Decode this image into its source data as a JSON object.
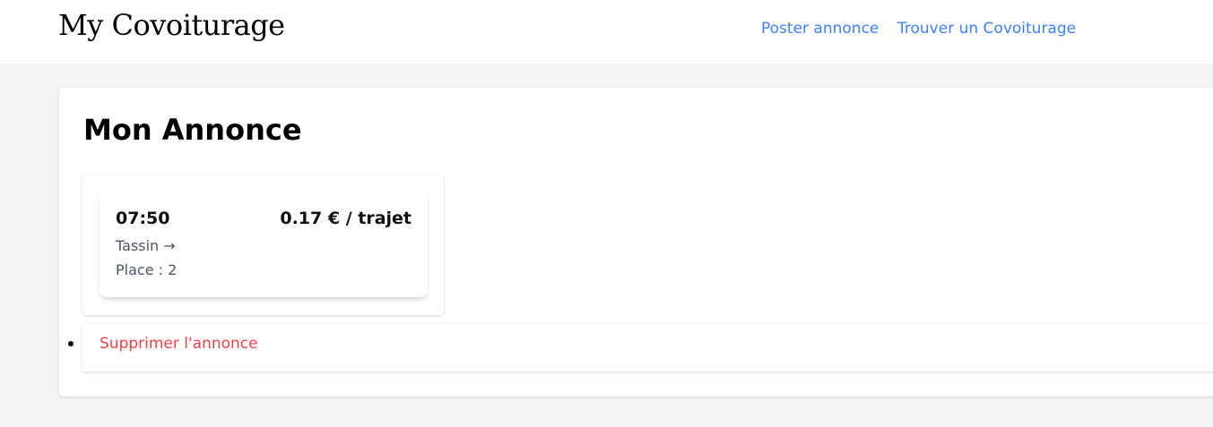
{
  "header": {
    "brand": "My Covoiturage",
    "nav": {
      "post_label": "Poster annonce",
      "find_label": "Trouver un Covoiturage"
    }
  },
  "main": {
    "title": "Mon Annonce",
    "ride": {
      "time": "07:50",
      "price": "0.17 € / trajet",
      "route": "Tassin →",
      "places": "Place : 2"
    },
    "actions": {
      "delete_label": "Supprimer l'annonce"
    }
  },
  "colors": {
    "link": "#3b82f6",
    "danger": "#ef4444",
    "background": "#f3f4f6"
  }
}
